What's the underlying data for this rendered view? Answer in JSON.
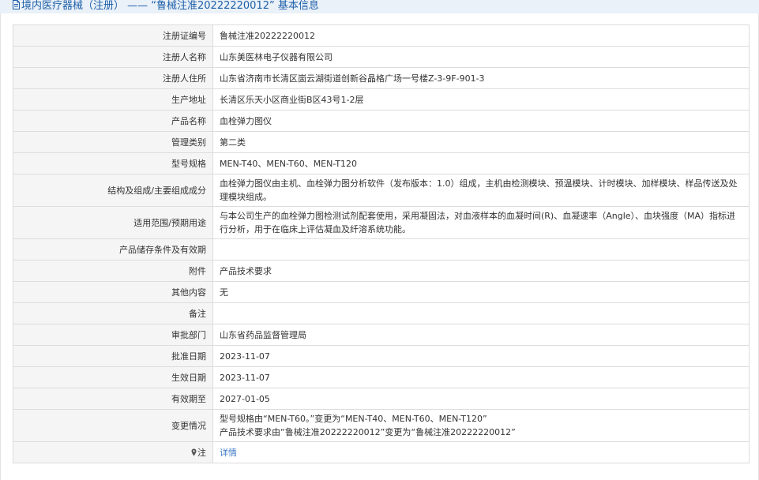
{
  "header": {
    "title": "境内医疗器械（注册） —— “鲁械注准20222220012” 基本信息",
    "icon": "document-icon"
  },
  "rows": [
    {
      "label": "注册证编号",
      "value": "鲁械注准20222220012"
    },
    {
      "label": "注册人名称",
      "value": "山东美医林电子仪器有限公司"
    },
    {
      "label": "注册人住所",
      "value": "山东省济南市长清区崮云湖街道创新谷晶格广场一号楼Z-3-9F-901-3"
    },
    {
      "label": "生产地址",
      "value": "长清区乐天小区商业街B区43号1-2层"
    },
    {
      "label": "产品名称",
      "value": "血栓弹力图仪"
    },
    {
      "label": "管理类别",
      "value": "第二类"
    },
    {
      "label": "型号规格",
      "value": "MEN-T40、MEN-T60、MEN-T120"
    },
    {
      "label": "结构及组成/主要组成成分",
      "value": "血栓弹力图仪由主机、血栓弹力图分析软件（发布版本：1.0）组成，主机由检测模块、预温模块、计时模块、加样模块、样品传送及处理模块组成。"
    },
    {
      "label": "适用范围/预期用途",
      "value": "与本公司生产的血栓弹力图检测试剂配套使用，采用凝固法，对血液样本的血凝时间(R)、血凝速率（Angle）、血块强度（MA）指标进行分析，用于在临床上评估凝血及纤溶系统功能。"
    },
    {
      "label": "产品储存条件及有效期",
      "value": ""
    },
    {
      "label": "附件",
      "value": "产品技术要求"
    },
    {
      "label": "其他内容",
      "value": "无"
    },
    {
      "label": "备注",
      "value": ""
    },
    {
      "label": "审批部门",
      "value": "山东省药品监督管理局"
    },
    {
      "label": "批准日期",
      "value": "2023-11-07"
    },
    {
      "label": "生效日期",
      "value": "2023-11-07"
    },
    {
      "label": "有效期至",
      "value": "2027-01-05"
    }
  ],
  "change": {
    "label": "变更情况",
    "line1": "型号规格由“MEN-T60。”变更为“MEN-T40、MEN-T60、MEN-T120”",
    "line2": "产品技术要求由“鲁械注准20222220012”变更为“鲁械注准20222220012”"
  },
  "note": {
    "label": "注",
    "icon": "pin-icon",
    "link": "详情"
  },
  "colors": {
    "header_bg": "#eaf1f8",
    "header_text": "#1d5fa8",
    "label_bg": "#f5f5f5",
    "border": "#dcdcdc",
    "link": "#3a78c6"
  }
}
